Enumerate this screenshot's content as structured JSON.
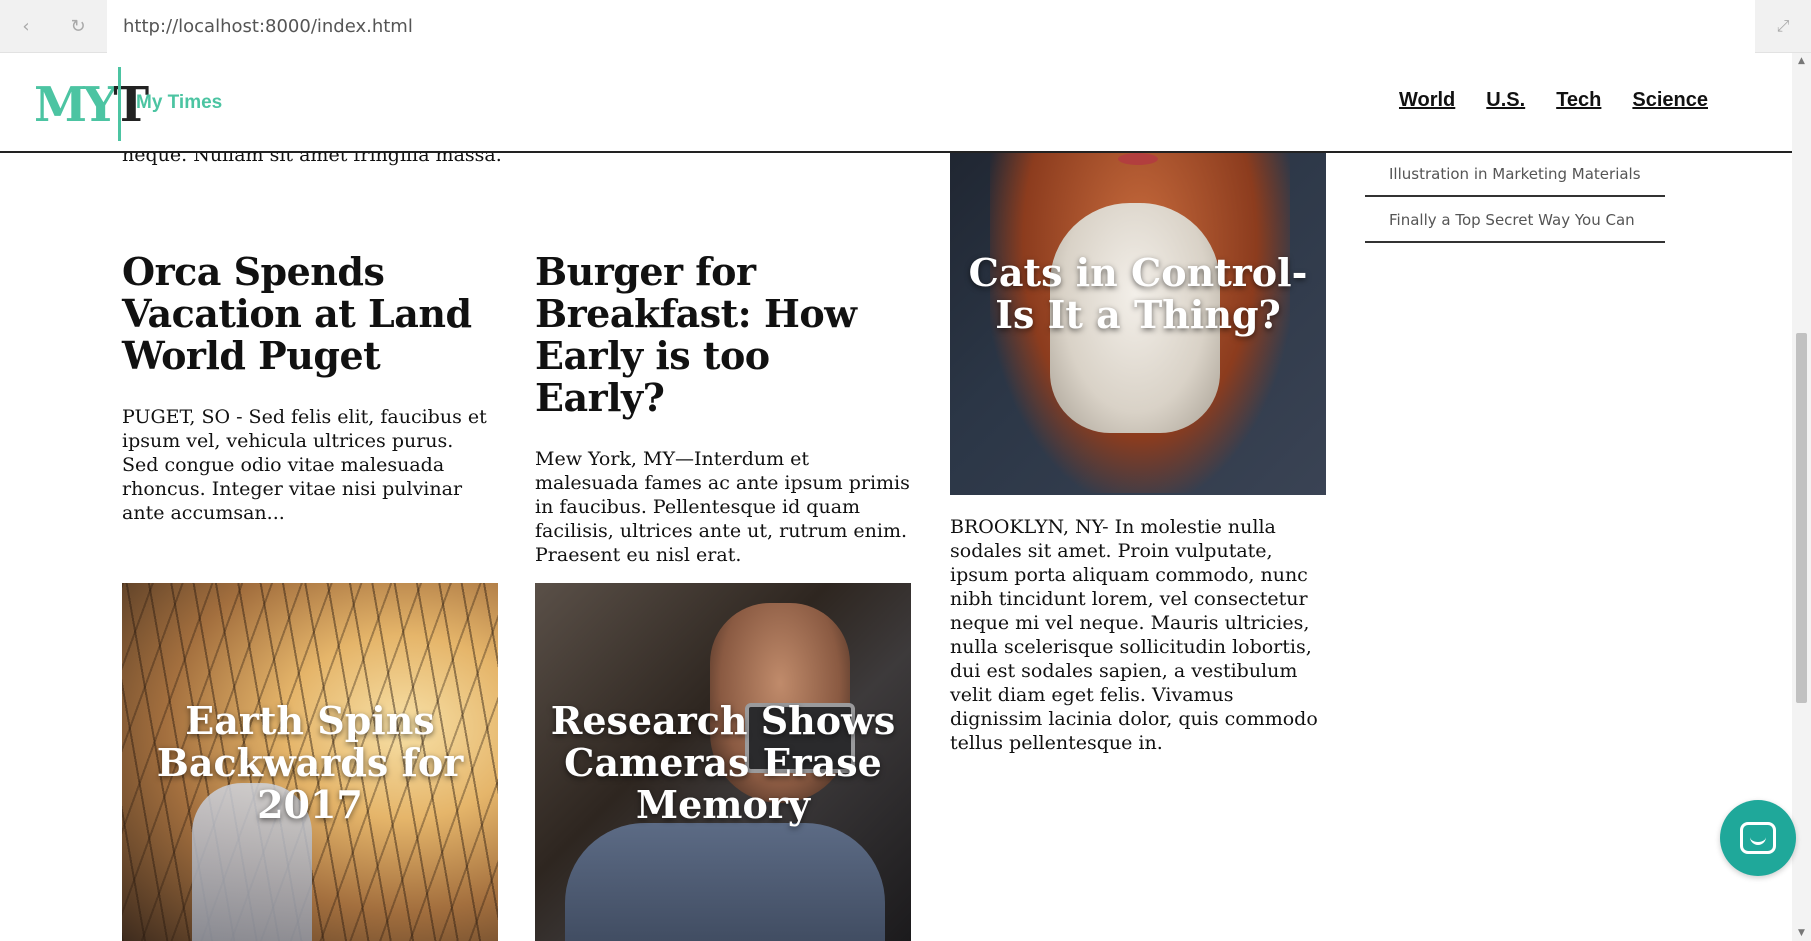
{
  "browser": {
    "url": "http://localhost:8000/index.html",
    "back_icon": "‹",
    "reload_icon": "↻",
    "expand_icon": "⤢"
  },
  "header": {
    "logo": {
      "m": "M",
      "y": "Y",
      "t": "T"
    },
    "site_name": "My Times",
    "nav": [
      "World",
      "U.S.",
      "Tech",
      "Science"
    ]
  },
  "main": {
    "intro_text": "scelerisque. Vestibulum aliquet placerat leo a hendrerit. Nulla non sagittis neque. Nullam sit amet fringilla massa.",
    "articles": [
      {
        "title": "Orca Spends Vacation at Land World Puget",
        "body": "PUGET, SO - Sed felis elit, faucibus et ipsum vel, vehicula ultrices purus. Sed congue odio vitae malesuada rhoncus. Integer vitae nisi pulvinar ante accumsan..."
      },
      {
        "title": "Burger for Breakfast: How Early is too Early?",
        "body": "Mew York, MY—Interdum et malesuada fames ac ante ipsum primis in faucibus. Pellentesque id quam facilisis, ultrices ante ut, rutrum enim. Praesent eu nisl erat."
      }
    ],
    "image_cards": [
      {
        "caption": "Earth Spins Backwards for 2017"
      },
      {
        "caption": "Research Shows Cameras Erase Memory"
      },
      {
        "caption": "Cats in Control-Is It a Thing?"
      }
    ],
    "cats_body": "BROOKLYN, NY- In molestie nulla sodales sit amet. Proin vulputate, ipsum porta aliquam commodo, nunc nibh tincidunt lorem, vel consectetur neque mi vel neque. Mauris ultricies, nulla scelerisque sollicitudin lobortis, dui est sodales sapien, a vestibulum velit diam eget felis. Vivamus dignissim lacinia dolor, quis commodo tellus pellentesque in."
  },
  "sidebar": {
    "items": [
      "Illustration in Marketing Materials",
      "Finally a Top Secret Way You Can"
    ]
  },
  "colors": {
    "accent": "#4cc4a2",
    "chat": "#1fa89a"
  }
}
